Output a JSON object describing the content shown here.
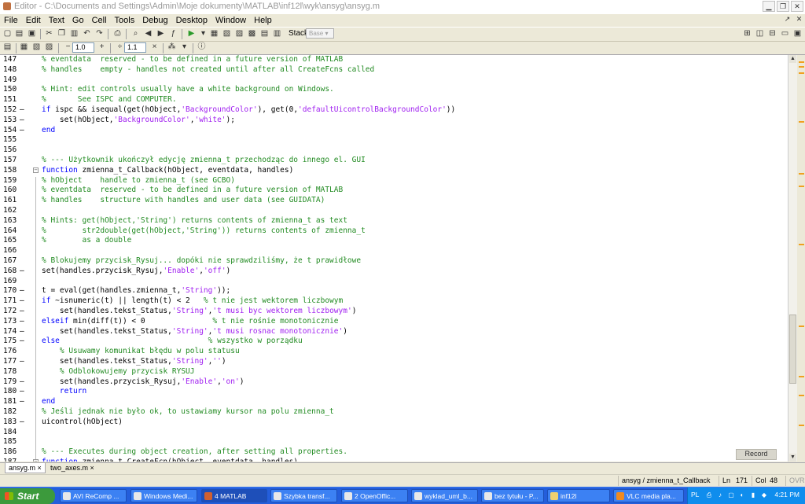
{
  "window": {
    "title": "Editor - C:\\Documents and Settings\\Admin\\Moje dokumenty\\MATLAB\\inf12l\\wyk\\ansyg\\ansyg.m"
  },
  "menu": [
    "File",
    "Edit",
    "Text",
    "Go",
    "Cell",
    "Tools",
    "Debug",
    "Desktop",
    "Window",
    "Help"
  ],
  "toolbar": {
    "stack_label": "Stack:",
    "stack_value": "Base",
    "cell_step_1": "1.0",
    "cell_step_2": "1.1"
  },
  "colors": {
    "keyword": "#0000ff",
    "comment": "#228b22",
    "string": "#a020f0"
  },
  "code_lines": [
    {
      "n": "147",
      "d": "",
      "segs": [
        [
          "c",
          "% eventdata  reserved - to be defined in a future version of MATLAB"
        ]
      ]
    },
    {
      "n": "148",
      "d": "",
      "segs": [
        [
          "c",
          "% handles    empty - handles not created until after all CreateFcns called"
        ]
      ]
    },
    {
      "n": "149",
      "d": "",
      "segs": []
    },
    {
      "n": "150",
      "d": "",
      "segs": [
        [
          "c",
          "% Hint: edit controls usually have a white background on Windows."
        ]
      ]
    },
    {
      "n": "151",
      "d": "",
      "segs": [
        [
          "c",
          "%       See ISPC and COMPUTER."
        ]
      ]
    },
    {
      "n": "152",
      "d": "–",
      "segs": [
        [
          "k",
          "if"
        ],
        [
          "t",
          " ispc && isequal(get(hObject,"
        ],
        [
          "s",
          "'BackgroundColor'"
        ],
        [
          "t",
          "), get(0,"
        ],
        [
          "s",
          "'defaultUicontrolBackgroundColor'"
        ],
        [
          "t",
          "))"
        ]
      ]
    },
    {
      "n": "153",
      "d": "–",
      "segs": [
        [
          "t",
          "    set(hObject,"
        ],
        [
          "s",
          "'BackgroundColor'"
        ],
        [
          "t",
          ","
        ],
        [
          "s",
          "'white'"
        ],
        [
          "t",
          ");"
        ]
      ]
    },
    {
      "n": "154",
      "d": "–",
      "segs": [
        [
          "k",
          "end"
        ]
      ]
    },
    {
      "n": "155",
      "d": "",
      "segs": []
    },
    {
      "n": "156",
      "d": "",
      "segs": []
    },
    {
      "n": "157",
      "d": "",
      "segs": [
        [
          "c",
          "% --- Użytkownik ukończył edycję zmienna_t przechodząc do innego el. GUI"
        ]
      ]
    },
    {
      "n": "158",
      "d": "",
      "fold": "−",
      "segs": [
        [
          "k",
          "function"
        ],
        [
          "t",
          " zmienna_t_Callback(hObject, eventdata, handles)"
        ]
      ]
    },
    {
      "n": "159",
      "d": "",
      "segs": [
        [
          "c",
          "% hObject    handle to zmienna_t (see GCBO)"
        ]
      ]
    },
    {
      "n": "160",
      "d": "",
      "segs": [
        [
          "c",
          "% eventdata  reserved - to be defined in a future version of MATLAB"
        ]
      ]
    },
    {
      "n": "161",
      "d": "",
      "segs": [
        [
          "c",
          "% handles    structure with handles and user data (see GUIDATA)"
        ]
      ]
    },
    {
      "n": "162",
      "d": "",
      "segs": []
    },
    {
      "n": "163",
      "d": "",
      "segs": [
        [
          "c",
          "% Hints: get(hObject,'String') returns contents of zmienna_t as text"
        ]
      ]
    },
    {
      "n": "164",
      "d": "",
      "segs": [
        [
          "c",
          "%        str2double(get(hObject,'String')) returns contents of zmienna_t"
        ]
      ]
    },
    {
      "n": "165",
      "d": "",
      "segs": [
        [
          "c",
          "%        as a double"
        ]
      ]
    },
    {
      "n": "166",
      "d": "",
      "segs": []
    },
    {
      "n": "167",
      "d": "",
      "segs": [
        [
          "c",
          "% Blokujemy przycisk_Rysuj... dopóki nie sprawdziliśmy, że t prawidłowe"
        ]
      ]
    },
    {
      "n": "168",
      "d": "–",
      "segs": [
        [
          "t",
          "set(handles.przycisk_Rysuj,"
        ],
        [
          "s",
          "'Enable'"
        ],
        [
          "t",
          ","
        ],
        [
          "s",
          "'off'"
        ],
        [
          "t",
          ")"
        ]
      ]
    },
    {
      "n": "169",
      "d": "",
      "segs": []
    },
    {
      "n": "170",
      "d": "–",
      "segs": [
        [
          "t",
          "t = eval(get(handles.zmienna_t,"
        ],
        [
          "s",
          "'String'"
        ],
        [
          "t",
          "));"
        ]
      ]
    },
    {
      "n": "171",
      "d": "–",
      "segs": [
        [
          "k",
          "if"
        ],
        [
          "t",
          " ~isnumeric(t) || length(t) < 2   "
        ],
        [
          "c",
          "% t nie jest wektorem liczbowym"
        ]
      ]
    },
    {
      "n": "172",
      "d": "–",
      "segs": [
        [
          "t",
          "    set(handles.tekst_Status,"
        ],
        [
          "s",
          "'String'"
        ],
        [
          "t",
          ","
        ],
        [
          "s",
          "'t musi byc wektorem liczbowym'"
        ],
        [
          "t",
          ")"
        ]
      ]
    },
    {
      "n": "173",
      "d": "–",
      "segs": [
        [
          "k",
          "elseif"
        ],
        [
          "t",
          " min(diff(t)) < 0               "
        ],
        [
          "c",
          "% t nie rośnie monotonicznie"
        ]
      ]
    },
    {
      "n": "174",
      "d": "–",
      "segs": [
        [
          "t",
          "    set(handles.tekst_Status,"
        ],
        [
          "s",
          "'String'"
        ],
        [
          "t",
          ","
        ],
        [
          "s",
          "'t musi rosnac monotonicznie'"
        ],
        [
          "t",
          ")"
        ]
      ]
    },
    {
      "n": "175",
      "d": "–",
      "segs": [
        [
          "k",
          "else"
        ],
        [
          "t",
          "                                 "
        ],
        [
          "c",
          "% wszystko w porządku"
        ]
      ]
    },
    {
      "n": "176",
      "d": "",
      "segs": [
        [
          "t",
          "    "
        ],
        [
          "c",
          "% Usuwamy komunikat błędu w polu statusu"
        ]
      ]
    },
    {
      "n": "177",
      "d": "–",
      "segs": [
        [
          "t",
          "    set(handles.tekst_Status,"
        ],
        [
          "s",
          "'String'"
        ],
        [
          "t",
          ","
        ],
        [
          "s",
          "''"
        ],
        [
          "t",
          ")"
        ]
      ]
    },
    {
      "n": "178",
      "d": "",
      "segs": [
        [
          "t",
          "    "
        ],
        [
          "c",
          "% Odblokowujemy przycisk RYSUJ"
        ]
      ]
    },
    {
      "n": "179",
      "d": "–",
      "segs": [
        [
          "t",
          "    set(handles.przycisk_Rysuj,"
        ],
        [
          "s",
          "'Enable'"
        ],
        [
          "t",
          ","
        ],
        [
          "s",
          "'on'"
        ],
        [
          "t",
          ")"
        ]
      ]
    },
    {
      "n": "180",
      "d": "–",
      "segs": [
        [
          "t",
          "    "
        ],
        [
          "k",
          "return"
        ]
      ]
    },
    {
      "n": "181",
      "d": "–",
      "segs": [
        [
          "k",
          "end"
        ]
      ]
    },
    {
      "n": "182",
      "d": "",
      "segs": [
        [
          "c",
          "% Jeśli jednak nie było ok, to ustawiamy kursor na polu zmienna_t"
        ]
      ]
    },
    {
      "n": "183",
      "d": "–",
      "segs": [
        [
          "t",
          "uicontrol(hObject)"
        ]
      ]
    },
    {
      "n": "184",
      "d": "",
      "segs": []
    },
    {
      "n": "185",
      "d": "",
      "segs": []
    },
    {
      "n": "186",
      "d": "",
      "segs": [
        [
          "c",
          "% --- Executes during object creation, after setting all properties."
        ]
      ]
    },
    {
      "n": "187",
      "d": "",
      "fold": "−",
      "segs": [
        [
          "k",
          "function"
        ],
        [
          "t",
          " zmienna_t_CreateFcn(hObject, eventdata, handles)"
        ]
      ]
    }
  ],
  "record_label": "Record",
  "doc_tabs": [
    "ansyg.m",
    "two_axes.m"
  ],
  "status": {
    "function": "ansyg / zmienna_t_Callback",
    "ln_label": "Ln",
    "ln": "171",
    "col_label": "Col",
    "col": "48",
    "mode": "OVR"
  },
  "taskbar": {
    "start": "Start",
    "tasks": [
      "AVI ReComp ...",
      "Windows Medi...",
      "4 MATLAB",
      "Szybka transf...",
      "2 OpenOffic...",
      "wyklad_uml_b...",
      "bez tytułu - P...",
      "inf12l",
      "VLC media pla..."
    ],
    "lang": "PL",
    "clock": "4:21 PM"
  }
}
